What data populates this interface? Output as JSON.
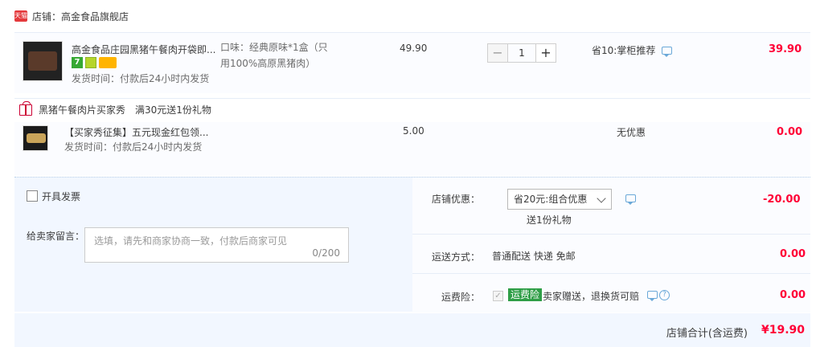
{
  "shop": {
    "badge": "天猫",
    "name": "店铺：高金食品旗舰店"
  },
  "items": [
    {
      "title": "高金食品庄园黑猪午餐肉开袋即...",
      "sku": "口味：经典原味*1盒（只用100%高原黑猪肉）",
      "ship": "发货时间：付款后24小时内发货",
      "price": "49.90",
      "qty": "1",
      "discount": "省10:掌柜推荐",
      "subtotal": "39.90",
      "icon7": "7"
    },
    {
      "title": "【买家秀征集】五元现金红包领...",
      "ship": "发货时间：付款后24小时内发货",
      "price": "5.00",
      "discount": "无优惠",
      "subtotal": "0.00"
    }
  ],
  "promo": {
    "name": "黑猪午餐肉片买家秀",
    "desc": "满30元送1份礼物"
  },
  "qty_controls": {
    "minus": "−",
    "plus": "+"
  },
  "invoice": {
    "label": "开具发票"
  },
  "message": {
    "label": "给卖家留言：",
    "placeholder": "选填，请先和商家协商一致，付款后商家可见",
    "counter": "0/200"
  },
  "shop_discount": {
    "label": "店铺优惠：",
    "selected": "省20元:组合优惠",
    "gift": "送1份礼物",
    "amount": "-20.00"
  },
  "shipping": {
    "label": "运送方式：",
    "value": "普通配送 快递 免邮",
    "amount": "0.00"
  },
  "insurance": {
    "label": "运费险：",
    "tag": "运费险",
    "desc": "卖家赠送，退换货可赔",
    "amount": "0.00",
    "check": "✓",
    "help": "?"
  },
  "total": {
    "label": "店铺合计(含运费)",
    "value": "¥19.90"
  }
}
